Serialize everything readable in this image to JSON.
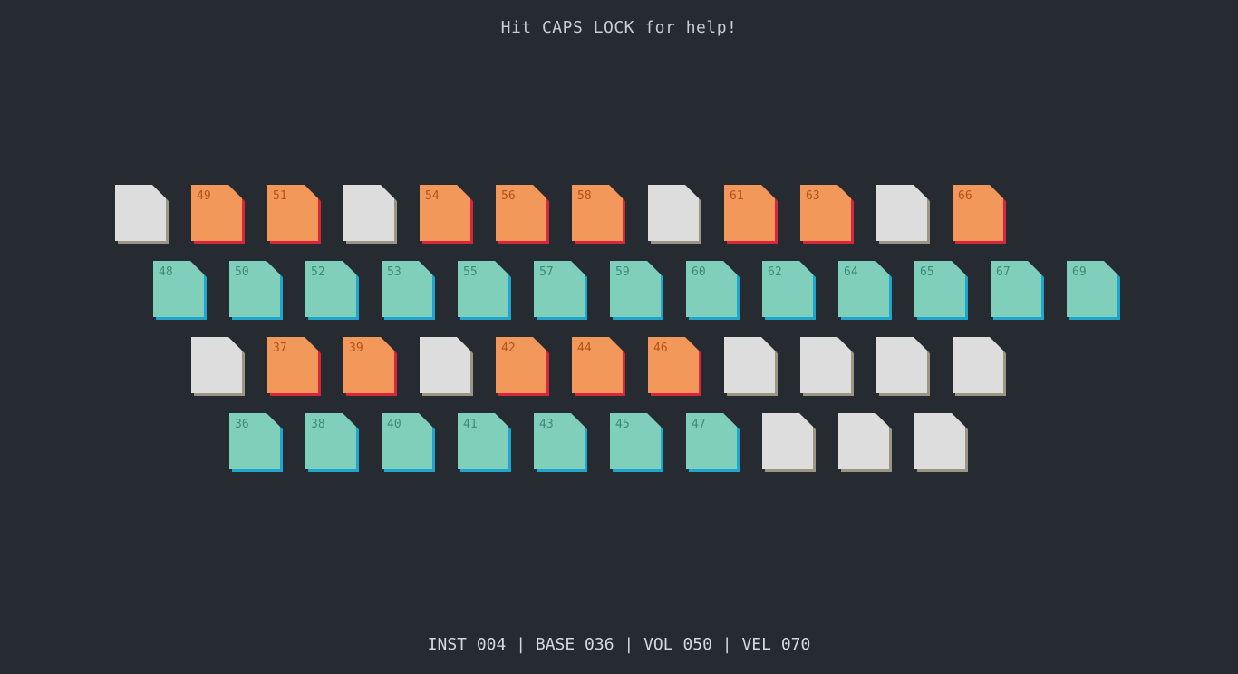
{
  "help_text": "Hit CAPS LOCK for help!",
  "status": {
    "inst": "INST 004",
    "base": "BASE 036",
    "vol": "VOL 050",
    "vel": "VEL 070",
    "separator": " | "
  },
  "colors": {
    "background": "#262a31",
    "sharp_key": "#f2985a",
    "sharp_key_shadow": "#d8263c",
    "natural_key": "#80cfbb",
    "natural_key_shadow": "#1fa6cf",
    "inactive_key": "#dddddd",
    "inactive_key_shadow": "#9b9684"
  },
  "rows": [
    {
      "keys": [
        "",
        "49",
        "51",
        "",
        "54",
        "56",
        "58",
        "",
        "61",
        "63",
        "",
        "66"
      ],
      "kind": "sharp"
    },
    {
      "keys": [
        "48",
        "50",
        "52",
        "53",
        "55",
        "57",
        "59",
        "60",
        "62",
        "64",
        "65",
        "67",
        "69"
      ],
      "kind": "natural"
    },
    {
      "keys": [
        "",
        "37",
        "39",
        "",
        "42",
        "44",
        "46",
        "",
        "",
        "",
        ""
      ],
      "kind": "sharp"
    },
    {
      "keys": [
        "36",
        "38",
        "40",
        "41",
        "43",
        "45",
        "47",
        "",
        "",
        ""
      ],
      "kind": "natural"
    }
  ]
}
